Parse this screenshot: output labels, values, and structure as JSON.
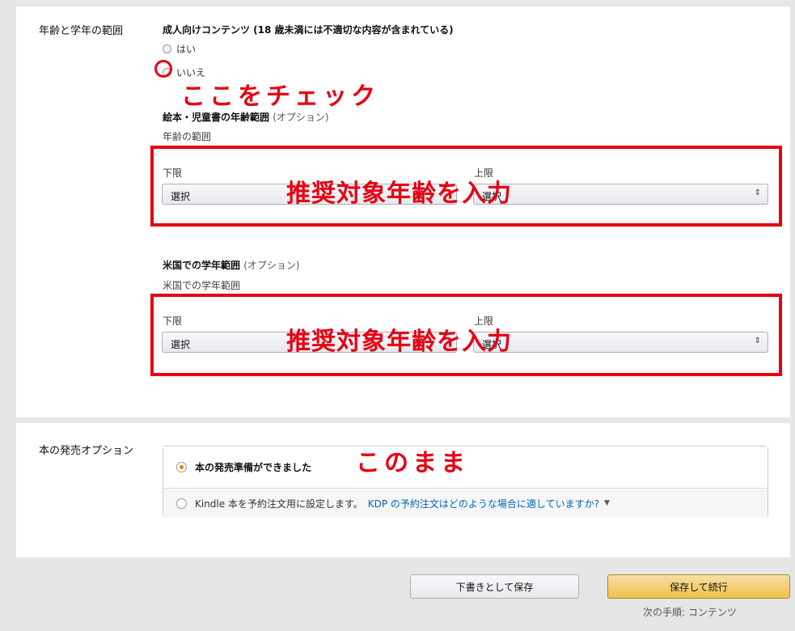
{
  "age_section": {
    "label": "年齢と学年の範囲",
    "adult_question": "成人向けコンテンツ (18 歳未満には不適切な内容が含まれている)",
    "option_yes": "はい",
    "option_no": "いいえ",
    "picture_book": {
      "title": "絵本・児童書の年齢範囲",
      "optional": "(オプション)",
      "sub": "年齢の範囲",
      "lower_label": "下限",
      "upper_label": "上限",
      "lower_value": "選択",
      "upper_value": "選択"
    },
    "us_grade": {
      "title": "米国での学年範囲",
      "optional": "(オプション)",
      "sub": "米国での学年範囲",
      "lower_label": "下限",
      "upper_label": "上限",
      "lower_value": "選択",
      "upper_value": "選択"
    }
  },
  "release_section": {
    "label": "本の発売オプション",
    "option_ready": "本の発売準備ができました",
    "option_preorder": "Kindle 本を予約注文用に設定します。",
    "preorder_link": "KDP の予約注文はどのような場合に適していますか?"
  },
  "annotations": {
    "check_here": "ここをチェック",
    "enter_age_1": "推奨対象年齢を入力",
    "enter_age_2": "推奨対象年齢を入力",
    "as_is": "このまま"
  },
  "footer": {
    "draft_button": "下書きとして保存",
    "save_button": "保存して続行",
    "next_step": "次の手順: コンテンツ"
  },
  "colors": {
    "annotation_red": "#e60012",
    "accent_orange": "#e47911",
    "link_blue": "#0066c0"
  },
  "icons": {
    "select_arrow": "updown-arrow-icon",
    "link_caret": "caret-down-icon"
  }
}
